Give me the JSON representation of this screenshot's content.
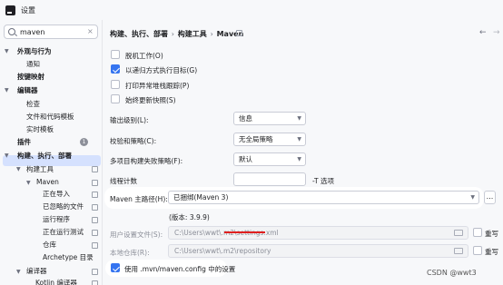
{
  "window": {
    "title": "设置"
  },
  "search": {
    "value": "maven",
    "clear": "×"
  },
  "sidebar": {
    "items": [
      {
        "label": "外观与行为"
      },
      {
        "label": "通知"
      },
      {
        "label": "按键映射"
      },
      {
        "label": "编辑器"
      },
      {
        "label": "检查"
      },
      {
        "label": "文件和代码模板"
      },
      {
        "label": "实时模板"
      },
      {
        "label": "插件"
      },
      {
        "label": "构建、执行、部署"
      },
      {
        "label": "构建工具"
      },
      {
        "label": "Maven"
      },
      {
        "label": "正在导入"
      },
      {
        "label": "已忽略的文件"
      },
      {
        "label": "运行程序"
      },
      {
        "label": "正在运行测试"
      },
      {
        "label": "仓库"
      },
      {
        "label": "Archetype 目录"
      },
      {
        "label": "编译器"
      },
      {
        "label": "Kotlin 编译器"
      }
    ],
    "plugins_badge": "1"
  },
  "breadcrumb": {
    "part1": "构建、执行、部署",
    "part2": "构建工具",
    "part3": "Maven",
    "sep": "›"
  },
  "nav": {
    "back": "←",
    "forward": "→"
  },
  "options": {
    "offline": "脱机工作(O)",
    "recursive": "以递归方式执行目标(G)",
    "exceptions": "打印异常堆栈跟踪(P)",
    "always_update": "始终更新快照(S)"
  },
  "form": {
    "output_level_label": "输出级别(L):",
    "output_level_value": "信息",
    "checksum_label": "校验和策略(C):",
    "checksum_value": "无全局策略",
    "multiproject_label": "多项目构建失败策略(F):",
    "multiproject_value": "默认",
    "thread_label": "线程计数",
    "thread_value": "",
    "thread_option": "-T 选项",
    "home_label": "Maven 主路径(H):",
    "home_value": "已捆绑(Maven 3)",
    "home_button": "...",
    "version": "(版本: 3.9.9)",
    "settings_label": "用户设置文件(S):",
    "settings_value": "C:\\Users\\wwt\\.m2\\settings.xml",
    "settings_override": "重写",
    "repo_label": "本地仓库(R):",
    "repo_value": "C:\\Users\\wwt\\.m2\\repository",
    "repo_override": "重写",
    "mvn_config": "使用 .mvn/maven.config 中的设置"
  },
  "watermark": "CSDN @wwt3",
  "colors": {
    "accent": "#3574f0",
    "selection": "#d5e1fe",
    "underline": "#e02020"
  }
}
